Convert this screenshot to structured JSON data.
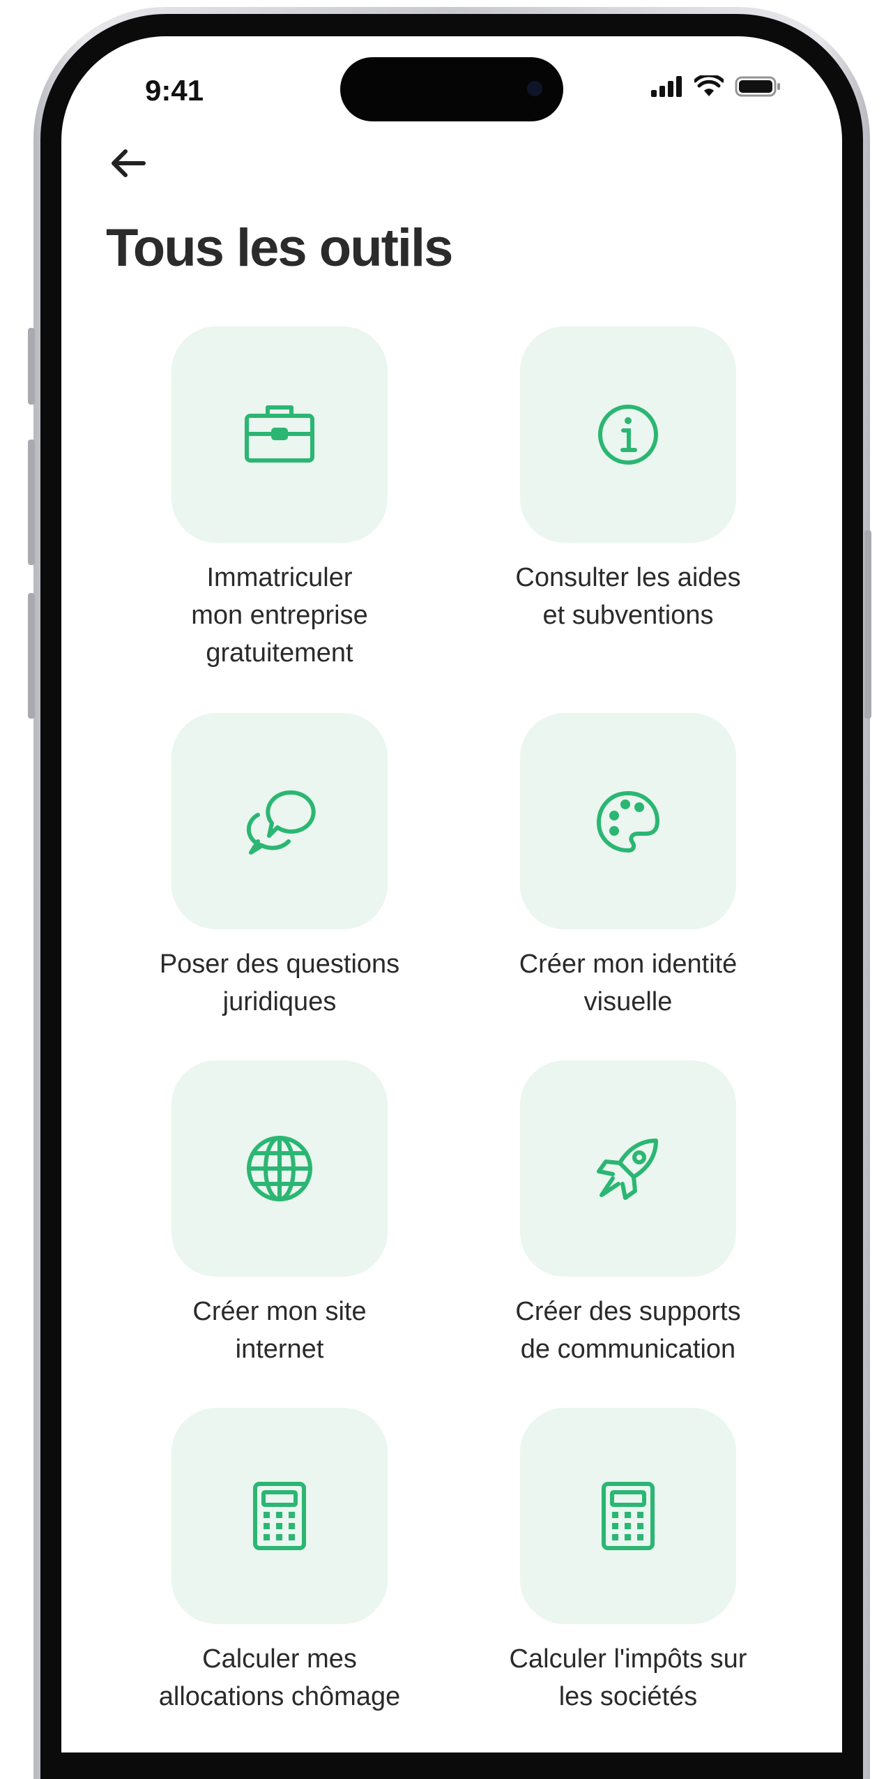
{
  "status_bar": {
    "time": "9:41"
  },
  "header": {
    "back_icon": "arrow-left-icon",
    "title": "Tous les outils"
  },
  "accent_color": "#2bb673",
  "tile_bg_color": "#eaf6ef",
  "tools": [
    {
      "label": "Immatriculer\nmon entreprise\ngratuitement",
      "icon": "briefcase-icon"
    },
    {
      "label": "Consulter les aides\net subventions",
      "icon": "info-icon"
    },
    {
      "label": "Poser des questions\njuridiques",
      "icon": "chat-bubbles-icon"
    },
    {
      "label": "Créer mon identité\nvisuelle",
      "icon": "palette-icon"
    },
    {
      "label": "Créer mon site\ninternet",
      "icon": "globe-icon"
    },
    {
      "label": "Créer des supports\nde communication",
      "icon": "rocket-icon"
    },
    {
      "label": "Calculer mes\nallocations chômage",
      "icon": "calculator-icon"
    },
    {
      "label": "Calculer l'impôts sur\nles sociétés",
      "icon": "calculator-icon"
    }
  ]
}
